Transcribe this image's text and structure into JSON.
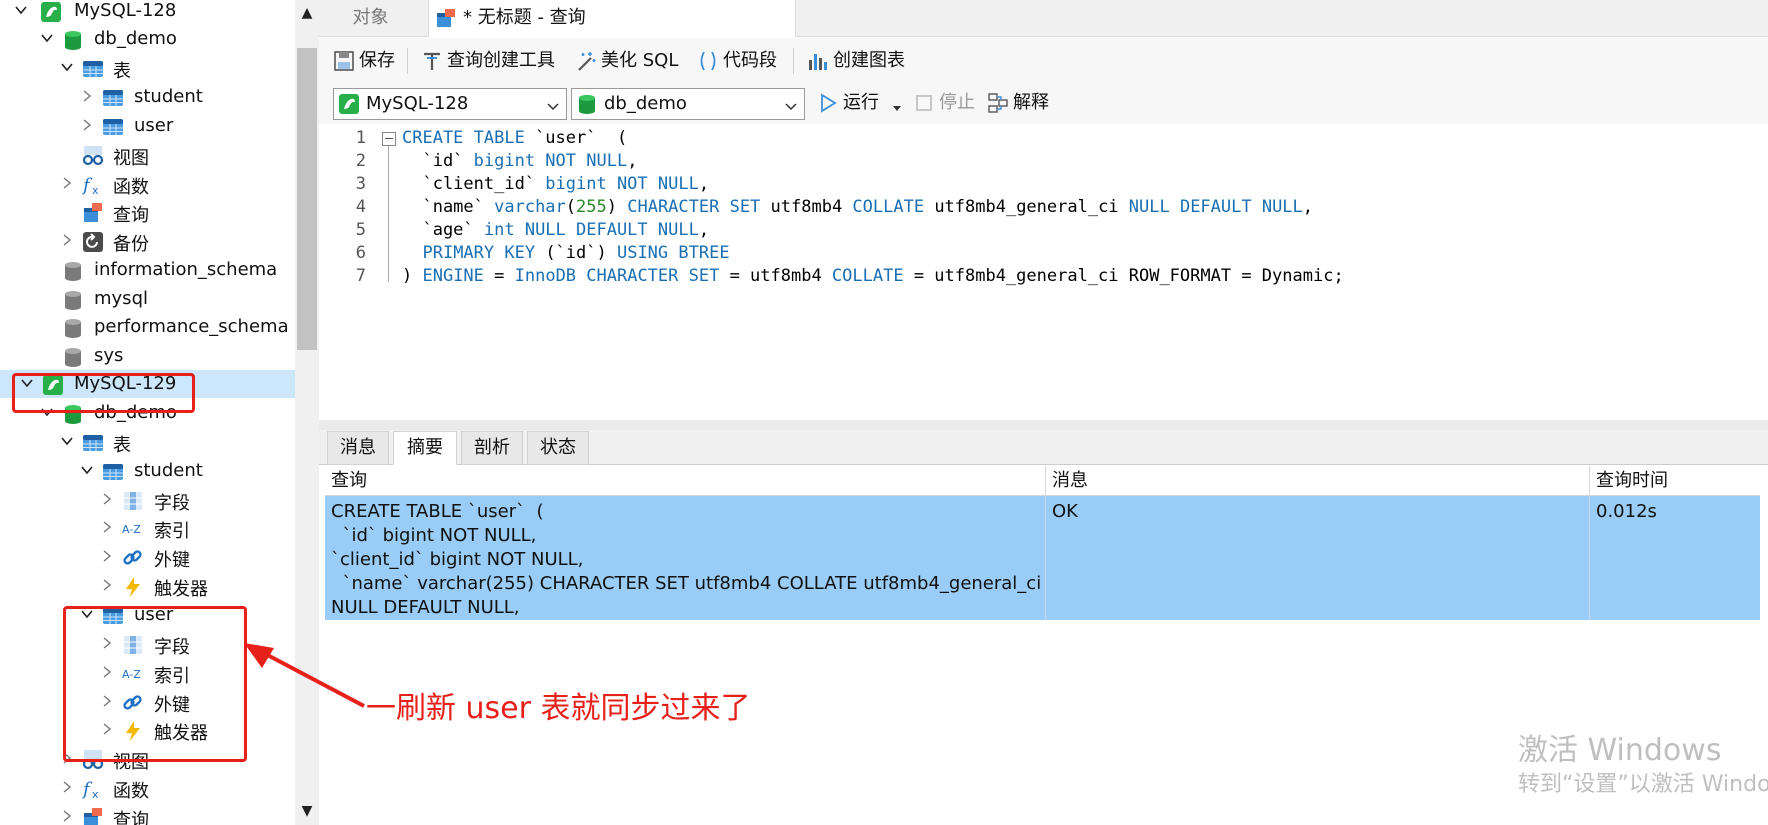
{
  "tree": {
    "rows": [
      {
        "label": "MySQL-128",
        "icon": "mysql-connection-icon"
      },
      {
        "label": "db_demo",
        "icon": "database-icon"
      },
      {
        "label": "表",
        "icon": "tables-icon"
      },
      {
        "label": "student",
        "icon": "table-icon"
      },
      {
        "label": "user",
        "icon": "table-icon"
      },
      {
        "label": "视图",
        "icon": "views-icon"
      },
      {
        "label": "函数",
        "icon": "functions-icon"
      },
      {
        "label": "查询",
        "icon": "queries-icon"
      },
      {
        "label": "备份",
        "icon": "backup-icon"
      },
      {
        "label": "information_schema",
        "icon": "database-gray-icon"
      },
      {
        "label": "mysql",
        "icon": "database-gray-icon"
      },
      {
        "label": "performance_schema",
        "icon": "database-gray-icon"
      },
      {
        "label": "sys",
        "icon": "database-gray-icon"
      },
      {
        "label": "MySQL-129",
        "icon": "mysql-connection-icon"
      },
      {
        "label": "db_demo",
        "icon": "database-icon"
      },
      {
        "label": "表",
        "icon": "tables-icon"
      },
      {
        "label": "student",
        "icon": "table-icon"
      },
      {
        "label": "字段",
        "icon": "fields-icon"
      },
      {
        "label": "索引",
        "icon": "index-icon"
      },
      {
        "label": "外键",
        "icon": "foreign-key-icon"
      },
      {
        "label": "触发器",
        "icon": "trigger-icon"
      },
      {
        "label": "user",
        "icon": "table-icon"
      },
      {
        "label": "字段",
        "icon": "fields-icon"
      },
      {
        "label": "索引",
        "icon": "index-icon"
      },
      {
        "label": "外键",
        "icon": "foreign-key-icon"
      },
      {
        "label": "触发器",
        "icon": "trigger-icon"
      },
      {
        "label": "视图",
        "icon": "views-icon"
      },
      {
        "label": "函数",
        "icon": "functions-icon"
      },
      {
        "label": "查询",
        "icon": "queries-icon"
      }
    ],
    "index_icon_text": "A-Z"
  },
  "tabs": {
    "objects": "对象",
    "query": "* 无标题 - 查询"
  },
  "toolbar": {
    "save": "保存",
    "query_builder": "查询创建工具",
    "beautify": "美化 SQL",
    "snippet": "代码段",
    "create_chart": "创建图表"
  },
  "toolbar2": {
    "connection": "MySQL-128",
    "database": "db_demo",
    "run": "运行",
    "stop": "停止",
    "explain": "解释"
  },
  "editor": {
    "line_numbers": [
      "1",
      "2",
      "3",
      "4",
      "5",
      "6",
      "7"
    ]
  },
  "results": {
    "tabs": [
      "消息",
      "摘要",
      "剖析",
      "状态"
    ],
    "columns": [
      "查询",
      "消息",
      "查询时间"
    ],
    "row": {
      "query": "CREATE TABLE `user`  (\n  `id` bigint NOT NULL,\n`client_id` bigint NOT NULL,\n  `name` varchar(255) CHARACTER SET utf8mb4 COLLATE utf8mb4_general_ci\nNULL DEFAULT NULL,",
      "message": "OK",
      "time": "0.012s"
    }
  },
  "annotation": {
    "text": "一刷新 user 表就同步过来了",
    "color": "#e8201a"
  },
  "watermark": {
    "line1": "激活 Windows",
    "line2": "转到“设置”以激活 Windows"
  },
  "colors": {
    "selection": "#cce6fb",
    "result_row": "#99ccf6",
    "keyword": "#1a6fb4"
  }
}
